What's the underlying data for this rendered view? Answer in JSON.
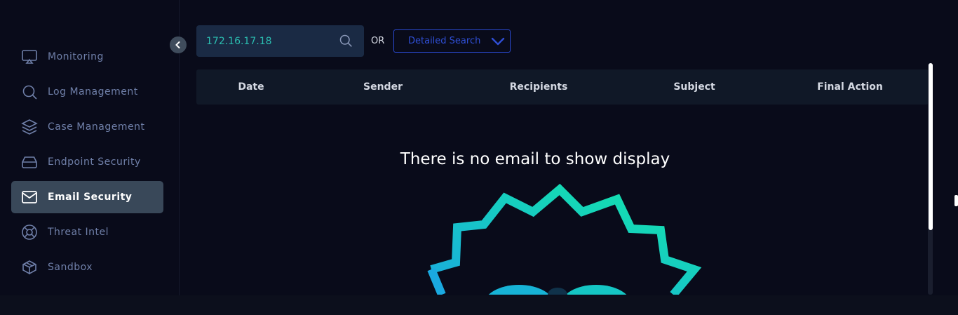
{
  "sidebar": {
    "items": [
      {
        "label": "Monitoring",
        "icon": "monitor-icon",
        "active": false
      },
      {
        "label": "Log Management",
        "icon": "search-icon",
        "active": false
      },
      {
        "label": "Case Management",
        "icon": "layers-icon",
        "active": false
      },
      {
        "label": "Endpoint Security",
        "icon": "hard-drive-icon",
        "active": false
      },
      {
        "label": "Email Security",
        "icon": "mail-icon",
        "active": true
      },
      {
        "label": "Threat Intel",
        "icon": "lifebuoy-icon",
        "active": false
      },
      {
        "label": "Sandbox",
        "icon": "box-icon",
        "active": false
      }
    ]
  },
  "search": {
    "value": "172.16.17.18",
    "or_label": "OR",
    "detailed_search_label": "Detailed Search"
  },
  "table": {
    "columns": [
      "Date",
      "Sender",
      "Recipients",
      "Subject",
      "Final Action"
    ]
  },
  "empty_state": {
    "message": "There is no email to show display"
  },
  "colors": {
    "background": "#090b1a",
    "active_item": "#394859",
    "search_text": "#2bbdb0",
    "accent_blue": "#2f4fd6",
    "illustration_gradient": [
      "#1aa9e0",
      "#13e8a8"
    ]
  }
}
